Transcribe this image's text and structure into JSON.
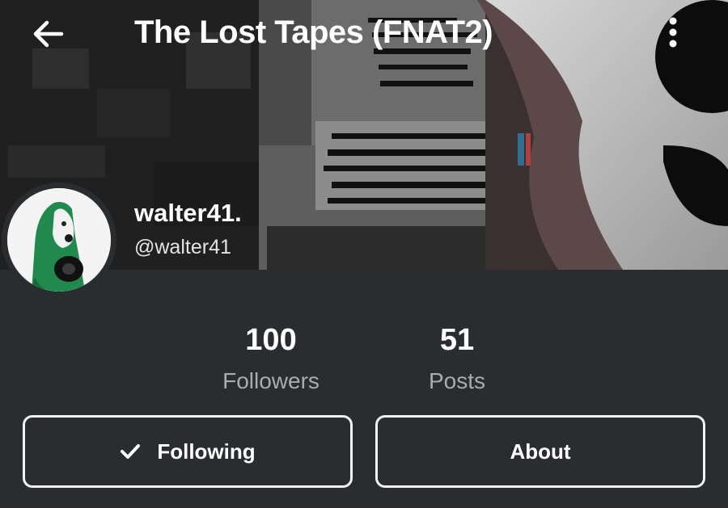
{
  "header": {
    "title": "The Lost Tapes (FNAT2)",
    "back_icon": "arrow-left-icon",
    "menu_icon": "more-vertical-icon"
  },
  "profile": {
    "display_name": "walter41.",
    "username": "@walter41"
  },
  "stats": [
    {
      "value": "100",
      "label": "Followers"
    },
    {
      "value": "51",
      "label": "Posts"
    }
  ],
  "buttons": {
    "following_label": "Following",
    "following_icon": "check-icon",
    "about_label": "About"
  },
  "colors": {
    "background": "#2a2d2f",
    "text": "#ffffff",
    "muted_text": "#a9abad",
    "avatar_green": "#1f8a4c"
  }
}
